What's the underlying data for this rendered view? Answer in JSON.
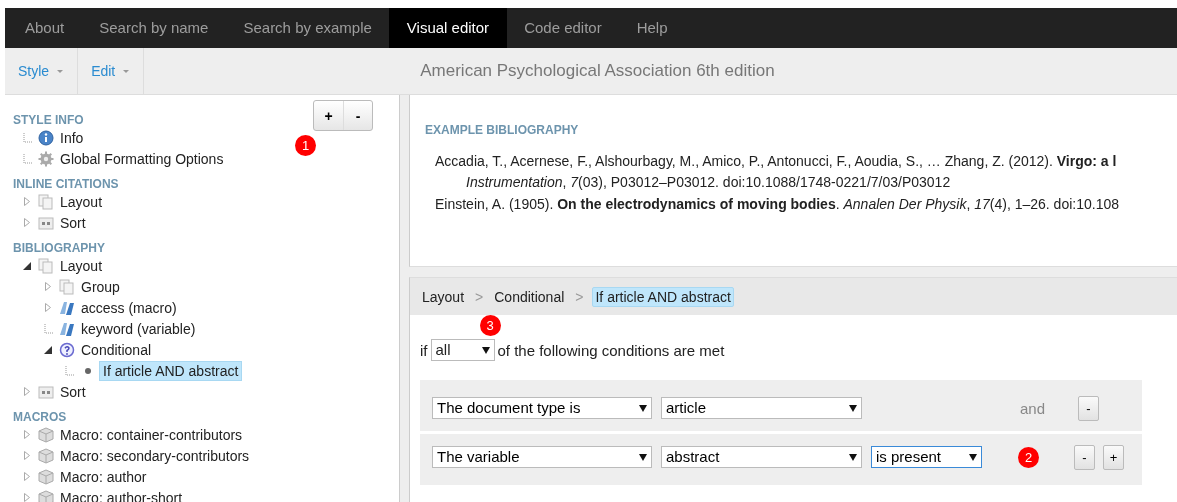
{
  "nav": {
    "tabs": [
      {
        "label": "About",
        "selected": false
      },
      {
        "label": "Search by name",
        "selected": false
      },
      {
        "label": "Search by example",
        "selected": false
      },
      {
        "label": "Visual editor",
        "selected": true
      },
      {
        "label": "Code editor",
        "selected": false
      },
      {
        "label": "Help",
        "selected": false
      }
    ]
  },
  "toolbar": {
    "menus": [
      {
        "label": "Style"
      },
      {
        "label": "Edit"
      }
    ],
    "style_title": "American Psychological Association 6th edition"
  },
  "sidebar": {
    "zoom_buttons": [
      "+",
      "-"
    ],
    "badge": "1",
    "sections": [
      {
        "heading": "STYLE INFO",
        "items": [
          {
            "label": "Info",
            "kind": "info",
            "leaf": true,
            "selected": false
          },
          {
            "label": "Global Formatting Options",
            "kind": "gear",
            "leaf": true,
            "selected": false
          }
        ]
      },
      {
        "heading": "INLINE CITATIONS",
        "items": [
          {
            "label": "Layout",
            "kind": "pages",
            "leaf": false,
            "expanded": false,
            "selected": false
          },
          {
            "label": "Sort",
            "kind": "sort",
            "leaf": false,
            "expanded": false,
            "selected": false
          }
        ]
      },
      {
        "heading": "BIBLIOGRAPHY",
        "items": [
          {
            "label": "Layout",
            "kind": "pages",
            "leaf": false,
            "expanded": true,
            "selected": false,
            "children": [
              {
                "label": "Group",
                "kind": "pages",
                "leaf": false,
                "expanded": false,
                "selected": false
              },
              {
                "label": "access (macro)",
                "kind": "text",
                "leaf": false,
                "expanded": false,
                "selected": false
              },
              {
                "label": "keyword (variable)",
                "kind": "text",
                "leaf": true,
                "selected": false
              },
              {
                "label": "Conditional",
                "kind": "question",
                "leaf": false,
                "expanded": true,
                "selected": false,
                "children": [
                  {
                    "label": "If article AND abstract",
                    "kind": "dot",
                    "leaf": true,
                    "selected": true
                  }
                ]
              }
            ]
          },
          {
            "label": "Sort",
            "kind": "sort",
            "leaf": false,
            "expanded": false,
            "selected": false
          }
        ]
      },
      {
        "heading": "MACROS",
        "items": [
          {
            "label": "Macro: container-contributors",
            "kind": "cube",
            "leaf": false,
            "expanded": false,
            "selected": false
          },
          {
            "label": "Macro: secondary-contributors",
            "kind": "cube",
            "leaf": false,
            "expanded": false,
            "selected": false
          },
          {
            "label": "Macro: author",
            "kind": "cube",
            "leaf": false,
            "expanded": false,
            "selected": false
          },
          {
            "label": "Macro: author-short",
            "kind": "cube",
            "leaf": false,
            "expanded": false,
            "selected": false
          }
        ]
      }
    ]
  },
  "example_bibliography": {
    "heading": "EXAMPLE BIBLIOGRAPHY",
    "entries": [
      {
        "lines": [
          "Accadia, T., Acernese, F., Alshourbagy, M., Amico, P., Antonucci, F., Aoudia, S., … Zhang, Z. (2012). **Virgo: a l**",
          "*Instrumentation*, *7*(03), P03012–P03012. doi:10.1088/1748-0221/7/03/P03012"
        ]
      },
      {
        "lines": [
          "Einstein, A. (1905). **On the electrodynamics of moving bodies**. *Annalen Der Physik*, *17*(4), 1–26. doi:10.108"
        ]
      }
    ]
  },
  "editor": {
    "breadcrumb": [
      {
        "kind": "link",
        "label": "Layout",
        "selected": false
      },
      {
        "kind": "separator",
        "label": ">"
      },
      {
        "kind": "link",
        "label": "Conditional",
        "selected": false
      },
      {
        "kind": "separator",
        "label": ">"
      },
      {
        "kind": "link",
        "label": "If article AND abstract",
        "selected": true
      }
    ],
    "match": {
      "prefix": "if",
      "value": "all",
      "suffix": "of the following conditions are met",
      "badge": "3"
    },
    "conditions": [
      {
        "field": "The document type is",
        "value": "article",
        "joiner": "and",
        "buttons": [
          "-"
        ]
      },
      {
        "field": "The variable",
        "value": "abstract",
        "test": "is present",
        "test_focused": true,
        "badge": "2",
        "buttons": [
          "-",
          "+"
        ]
      }
    ]
  }
}
